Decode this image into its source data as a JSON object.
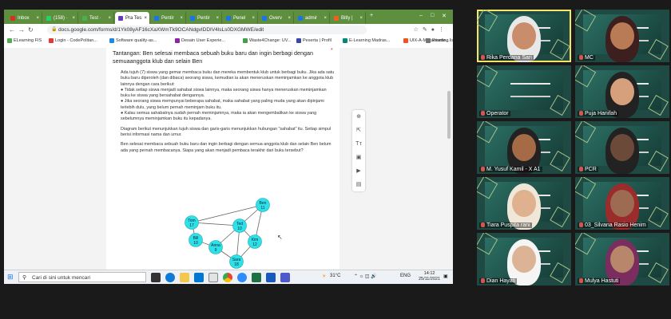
{
  "browser": {
    "tabs": [
      {
        "label": "Inbox",
        "fav": "#d93025"
      },
      {
        "label": "(158) ·",
        "fav": "#25d366"
      },
      {
        "label": "Test ·",
        "fav": "#4caf50"
      },
      {
        "label": "Pra Tes",
        "fav": "#673ab7",
        "active": true
      },
      {
        "label": "Pentir",
        "fav": "#1a73e8"
      },
      {
        "label": "Pentir",
        "fav": "#1a73e8"
      },
      {
        "label": "Penel",
        "fav": "#1a73e8"
      },
      {
        "label": "Overv",
        "fav": "#1a73e8"
      },
      {
        "label": "admir",
        "fav": "#1a73e8"
      },
      {
        "label": "Bitly |",
        "fav": "#ee6123"
      }
    ],
    "url": "docs.google.com/forms/d/1Yk08yAF16cXaXWmTk9OCANdgvIDDIV4lsLs0DXGMWE/edit",
    "bookmarks": [
      {
        "label": "ELearning FIS",
        "color": "#4caf50"
      },
      {
        "label": "Login - CodePolitan...",
        "color": "#e53935"
      },
      {
        "label": "Software quality-as...",
        "color": "#1e88e5"
      },
      {
        "label": "Desain User Experie...",
        "color": "#8e24aa"
      },
      {
        "label": "Waste4Change: UV...",
        "color": "#43a047"
      },
      {
        "label": "Peserta | Profil",
        "color": "#3949ab"
      },
      {
        "label": "E-Learning Madras...",
        "color": "#00897b"
      },
      {
        "label": "UIX-A-Mekanisme...",
        "color": "#f4511e"
      },
      {
        "label": "Reading list",
        "color": "#757575"
      }
    ]
  },
  "form": {
    "question": "Tantangan: Ben selesai membaca sebuah buku baru dan ingin berbagi dengan semuaanggota klub dan selain Ben",
    "required_mark": "*",
    "paragraphs": [
      "Ada tujuh (7) siswa yang gemar membaca buku dan mereka membentuk klub untuk berbagi buku. Jika ada satu buku baru diperoleh (dan dibaca) seorang siswa, kemudian ia akan meneruskan meminjamkan ke anggota klub lainnya dengan cara berikut:",
      "● Tidak setiap siswa menjadi sahabat siswa lainnya, maka seorang siswa hanya meneruskan meminjamkan buku ke siswa yang bersahabat dengannya.",
      "● Jika seorang siswa mempunyai beberapa sahabat, maka sahabat yang paling muda yang akan dipinjami terlebih dulu, yang belum pernah meminjam buku itu.",
      "● Kalau semua sahabatnya sudah pernah meminjamnya, maka ia akan mengembalikan ke siswa yang sebelumnya meminjamkan buku itu kepadanya."
    ],
    "diagram_caption": "Diagram berikut menunjukkan tujuh siswa dan garis-garis menunjukkan hubungan \"sahabat\" itu. Setiap simpul berisi informasi nama dan umur.",
    "question_text": "Ben selesai membaca sebuah buku baru dan ingin berbagi dengan semua anggota klub dan selain Ben belum ada yang pernah membacanya. Siapa yang akan menjadi pembaca terakhir dari buku tersebut?",
    "graph": {
      "nodes": [
        {
          "id": "ben",
          "name": "Ben",
          "age": "11"
        },
        {
          "id": "tom",
          "name": "Tom",
          "age": "17"
        },
        {
          "id": "ted",
          "name": "Ted",
          "age": "10"
        },
        {
          "id": "bill",
          "name": "Bill",
          "age": "10"
        },
        {
          "id": "kim",
          "name": "Kim",
          "age": "12"
        },
        {
          "id": "anna",
          "name": "Anna",
          "age": "9"
        },
        {
          "id": "sara",
          "name": "Sara",
          "age": "18"
        }
      ],
      "edges": [
        [
          "ben",
          "tom"
        ],
        [
          "ben",
          "ted"
        ],
        [
          "ben",
          "kim"
        ],
        [
          "tom",
          "ted"
        ],
        [
          "tom",
          "bill"
        ],
        [
          "ted",
          "anna"
        ],
        [
          "ted",
          "kim"
        ],
        [
          "bill",
          "anna"
        ],
        [
          "anna",
          "sara"
        ],
        [
          "sara",
          "kim"
        ],
        [
          "ted",
          "sara"
        ]
      ]
    }
  },
  "taskbar": {
    "search_placeholder": "Cari di sini untuk mencari",
    "temperature": "31°C",
    "language": "ENG",
    "time": "14:12",
    "date": "25/11/2021"
  },
  "participants": [
    {
      "name": "Rika Perdana Sari",
      "type": "face"
    },
    {
      "name": "MC",
      "type": "face"
    },
    {
      "name": "Operator",
      "type": "slide"
    },
    {
      "name": "Puja Hanifah",
      "type": "face"
    },
    {
      "name": "M. Yusuf Kamil - X A1",
      "type": "face"
    },
    {
      "name": "PCR",
      "type": "face"
    },
    {
      "name": "Tiara Puspita rani",
      "type": "face"
    },
    {
      "name": "03_Silvana Rasio Henim",
      "type": "face"
    },
    {
      "name": "Dian Hayati",
      "type": "face"
    },
    {
      "name": "Mulya Hastuti",
      "type": "face"
    }
  ]
}
